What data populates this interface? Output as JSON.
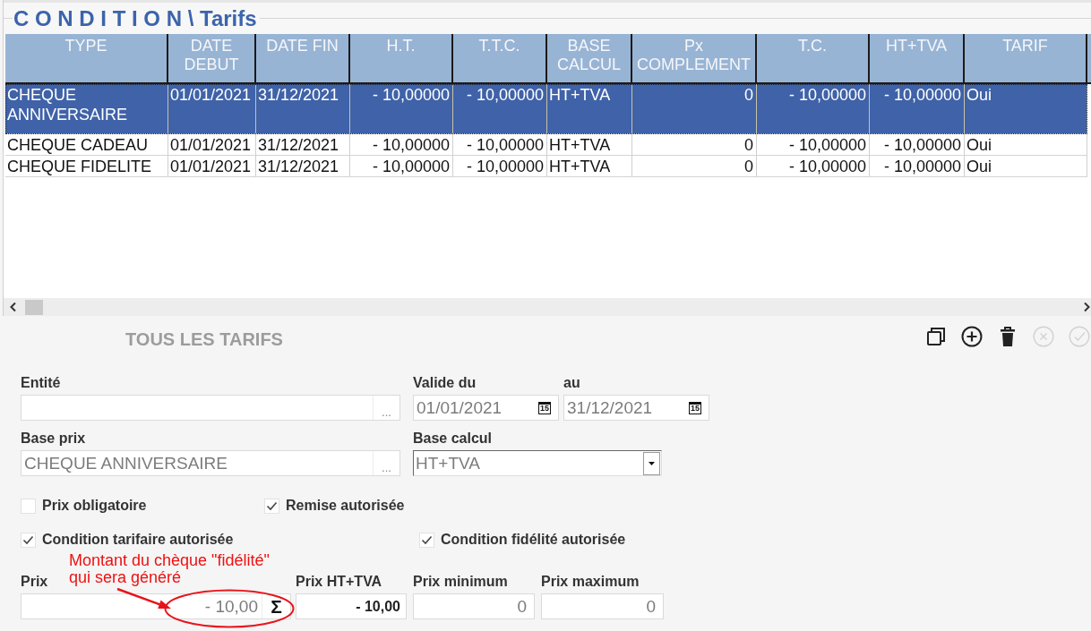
{
  "title": "C O N D I T I O N \\ Tarifs",
  "table": {
    "columns": [
      "TYPE",
      "DATE DEBUT",
      "DATE FIN",
      "H.T.",
      "T.T.C.",
      "BASE CALCUL",
      "Px COMPLEMENT",
      "T.C.",
      "HT+TVA",
      "TARIF"
    ],
    "rows": [
      {
        "selected": true,
        "cells": [
          "CHEQUE ANNIVERSAIRE",
          "01/01/2021",
          "31/12/2021",
          "- 10,00000",
          "- 10,00000",
          "HT+TVA",
          "0",
          "- 10,00000",
          "- 10,00000",
          "Oui"
        ]
      },
      {
        "selected": false,
        "cells": [
          "CHEQUE CADEAU",
          "01/01/2021",
          "31/12/2021",
          "- 10,00000",
          "- 10,00000",
          "HT+TVA",
          "0",
          "- 10,00000",
          "- 10,00000",
          "Oui"
        ]
      },
      {
        "selected": false,
        "cells": [
          "CHEQUE FIDELITE",
          "01/01/2021",
          "31/12/2021",
          "- 10,00000",
          "- 10,00000",
          "HT+TVA",
          "0",
          "- 10,00000",
          "- 10,00000",
          "Oui"
        ]
      }
    ]
  },
  "panel": {
    "title": "TOUS LES TARIFS",
    "toolbar": [
      {
        "kind": "duplicate",
        "disabled": false
      },
      {
        "kind": "add",
        "disabled": false
      },
      {
        "kind": "delete",
        "disabled": false
      },
      {
        "kind": "cancel",
        "disabled": true
      },
      {
        "kind": "validate",
        "disabled": true
      }
    ],
    "form": {
      "entity": {
        "label": "Entité",
        "browse": "..."
      },
      "valid_from": {
        "label": "Valide du",
        "value": "01/01/2021",
        "disabled": true,
        "picker": "15"
      },
      "valid_to": {
        "label": "au",
        "value": "31/12/2021",
        "disabled": true,
        "picker": "15"
      },
      "base_price": {
        "label": "Base prix",
        "value": "CHEQUE ANNIVERSAIRE",
        "disabled": true,
        "browse": "..."
      },
      "calc_base": {
        "label": "Base calcul",
        "value": "HT+TVA",
        "disabled": true
      },
      "checkboxes": [
        {
          "label": "Prix obligatoire",
          "checked": false
        },
        {
          "label": "Remise autorisée",
          "checked": true
        },
        {
          "label": "Condition tarifaire autorisée",
          "checked": true
        },
        {
          "label": "Condition fidélité autorisée",
          "checked": true
        }
      ],
      "price": {
        "label": "Prix",
        "value": "- 10,00",
        "disabled": true,
        "sum": "Σ"
      },
      "price_ht_tva": {
        "label": "Prix HT+TVA",
        "value": "- 10,00",
        "disabled": false
      },
      "price_min": {
        "label": "Prix minimum",
        "value": "0",
        "disabled": true
      },
      "price_max": {
        "label": "Prix maximum",
        "value": "0",
        "disabled": true
      }
    }
  },
  "annotation": {
    "lines": [
      "Montant du chèque \"fidélité\"",
      "qui sera généré"
    ]
  }
}
